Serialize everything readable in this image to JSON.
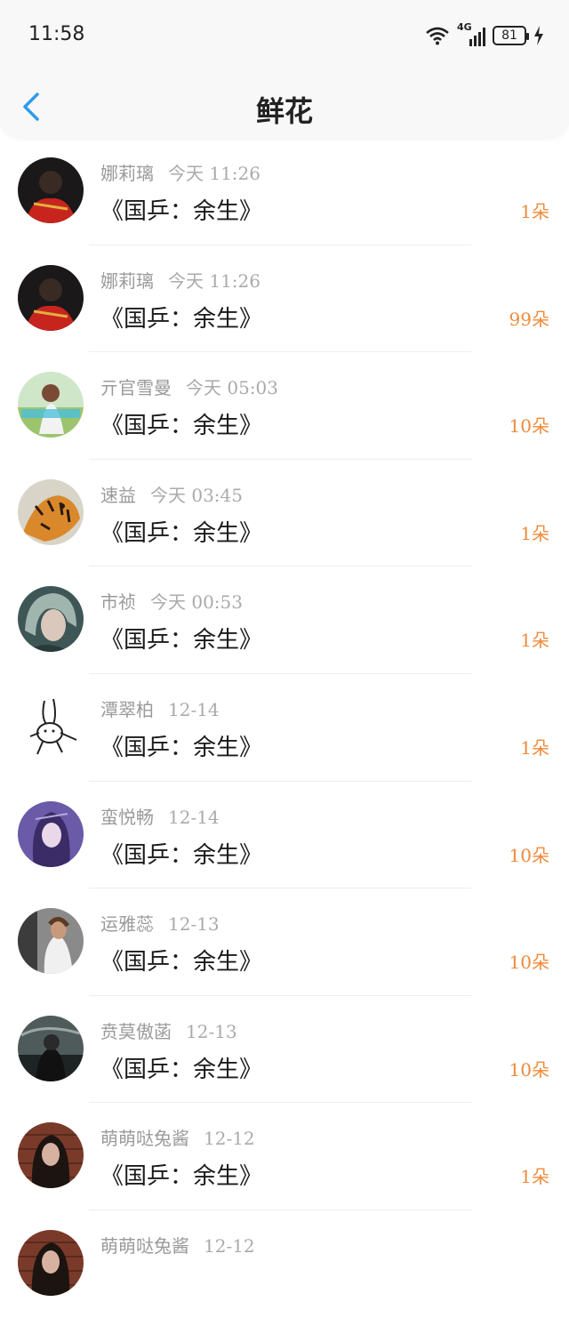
{
  "status_bar": {
    "time": "11:58",
    "network": "4G",
    "battery": "81"
  },
  "header": {
    "title": "鲜花"
  },
  "colors": {
    "accent": "#2f9be8",
    "quantity": "#f08a3a"
  },
  "rows": [
    {
      "name": "娜莉璃",
      "time": "今天  11:26",
      "work": "《国乒：余生》",
      "qty": "1朵",
      "avatar": "avatar-red-outfit"
    },
    {
      "name": "娜莉璃",
      "time": "今天  11:26",
      "work": "《国乒：余生》",
      "qty": "99朵",
      "avatar": "avatar-red-outfit"
    },
    {
      "name": "亓官雪曼",
      "time": "今天  05:03",
      "work": "《国乒：余生》",
      "qty": "10朵",
      "avatar": "avatar-girl-field"
    },
    {
      "name": "速益",
      "time": "今天  03:45",
      "work": "《国乒：余生》",
      "qty": "1朵",
      "avatar": "avatar-tiger"
    },
    {
      "name": "市祯",
      "time": "今天  00:53",
      "work": "《国乒：余生》",
      "qty": "1朵",
      "avatar": "avatar-anime-boy"
    },
    {
      "name": "潭翠柏",
      "time": "12-14",
      "work": "《国乒：余生》",
      "qty": "1朵",
      "avatar": "avatar-rabbit-sketch"
    },
    {
      "name": "蛮悦畅",
      "time": "12-14",
      "work": "《国乒：余生》",
      "qty": "10朵",
      "avatar": "avatar-purple-anime"
    },
    {
      "name": "运雅蕊",
      "time": "12-13",
      "work": "《国乒：余生》",
      "qty": "10朵",
      "avatar": "avatar-woman-window"
    },
    {
      "name": "贲莫傲菡",
      "time": "12-13",
      "work": "《国乒：余生》",
      "qty": "10朵",
      "avatar": "avatar-dark-street"
    },
    {
      "name": "萌萌哒兔酱",
      "time": "12-12",
      "work": "《国乒：余生》",
      "qty": "1朵",
      "avatar": "avatar-woman-brick"
    },
    {
      "name": "萌萌哒兔酱",
      "time": "12-12",
      "work": "",
      "qty": "",
      "avatar": "avatar-woman-brick"
    }
  ]
}
